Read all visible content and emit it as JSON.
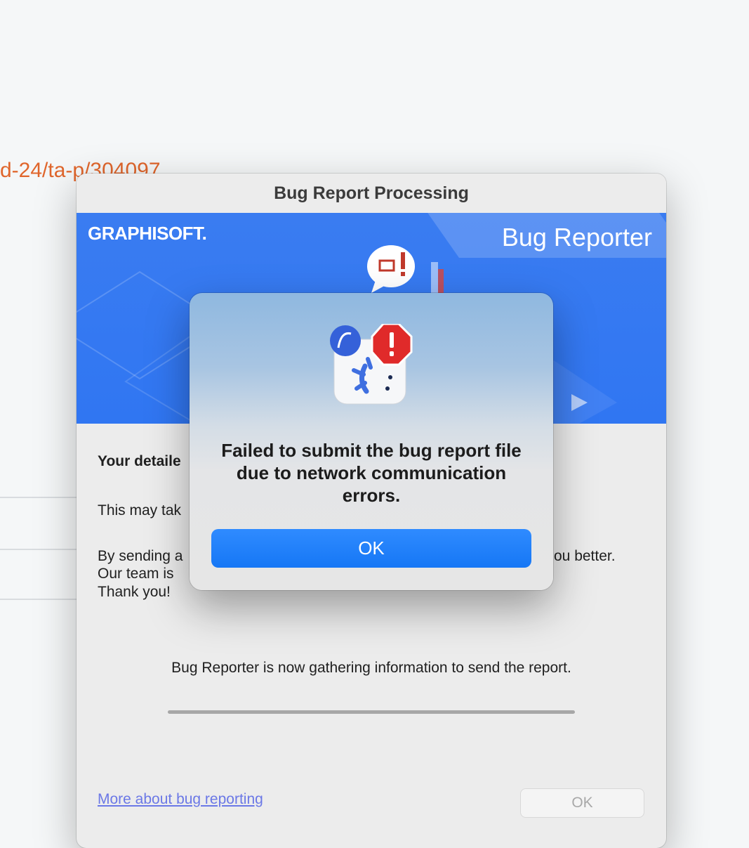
{
  "background": {
    "url_fragment": "d-24/ta-p/304097"
  },
  "window": {
    "title": "Bug Report Processing",
    "banner": {
      "logo": "GRAPHISOFT.",
      "product": "Bug Reporter"
    },
    "heading": "Your detaile",
    "line1": "This may tak",
    "para_line1_left": "By sending a",
    "para_line1_right": "ou better.",
    "para_line2": "Our team is",
    "para_line3": "Thank you!",
    "status": "Bug Reporter is now gathering information to send the report.",
    "link": "More about bug reporting",
    "ok_label": "OK"
  },
  "alert": {
    "message": "Failed to submit the bug report file due to network communication errors.",
    "ok_label": "OK",
    "icon": "app-warning-icon",
    "accent": "#1677f5"
  }
}
